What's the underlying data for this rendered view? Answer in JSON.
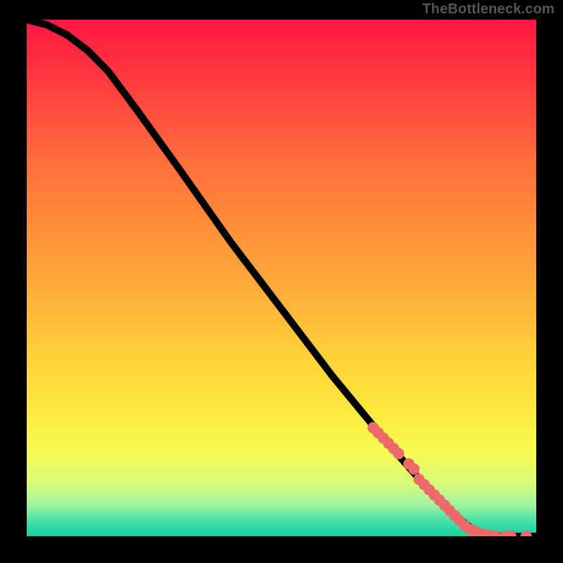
{
  "watermark": "TheBottleneck.com",
  "chart_data": {
    "type": "line",
    "title": "",
    "xlabel": "",
    "ylabel": "",
    "xlim": [
      0,
      100
    ],
    "ylim": [
      0,
      100
    ],
    "grid": false,
    "legend": false,
    "curve": [
      {
        "x": 0,
        "y": 100
      },
      {
        "x": 4,
        "y": 99
      },
      {
        "x": 8,
        "y": 97
      },
      {
        "x": 12,
        "y": 94
      },
      {
        "x": 16,
        "y": 90
      },
      {
        "x": 22,
        "y": 82
      },
      {
        "x": 30,
        "y": 71
      },
      {
        "x": 40,
        "y": 57
      },
      {
        "x": 50,
        "y": 44
      },
      {
        "x": 60,
        "y": 31
      },
      {
        "x": 70,
        "y": 19
      },
      {
        "x": 78,
        "y": 10
      },
      {
        "x": 84,
        "y": 4
      },
      {
        "x": 88,
        "y": 1
      },
      {
        "x": 92,
        "y": 0
      },
      {
        "x": 100,
        "y": 0
      }
    ],
    "points_on_curve": [
      {
        "x": 68,
        "y": 21
      },
      {
        "x": 69,
        "y": 20
      },
      {
        "x": 70,
        "y": 19
      },
      {
        "x": 71,
        "y": 18
      },
      {
        "x": 72,
        "y": 17
      },
      {
        "x": 73,
        "y": 16
      },
      {
        "x": 75,
        "y": 14
      },
      {
        "x": 76,
        "y": 13
      },
      {
        "x": 77,
        "y": 11
      },
      {
        "x": 78,
        "y": 10
      },
      {
        "x": 79,
        "y": 9
      },
      {
        "x": 80,
        "y": 8
      },
      {
        "x": 81,
        "y": 7
      },
      {
        "x": 82,
        "y": 6
      },
      {
        "x": 83,
        "y": 5
      },
      {
        "x": 84,
        "y": 4
      },
      {
        "x": 85,
        "y": 3
      },
      {
        "x": 86,
        "y": 2
      },
      {
        "x": 87,
        "y": 1.3
      },
      {
        "x": 88,
        "y": 1
      },
      {
        "x": 89,
        "y": 0.5
      },
      {
        "x": 90,
        "y": 0.3
      },
      {
        "x": 91,
        "y": 0.15
      },
      {
        "x": 92,
        "y": 0
      },
      {
        "x": 94,
        "y": 0
      },
      {
        "x": 95,
        "y": 0
      },
      {
        "x": 98,
        "y": 0
      }
    ],
    "marker_color": "#ed6a6a",
    "line_color": "#000000"
  }
}
